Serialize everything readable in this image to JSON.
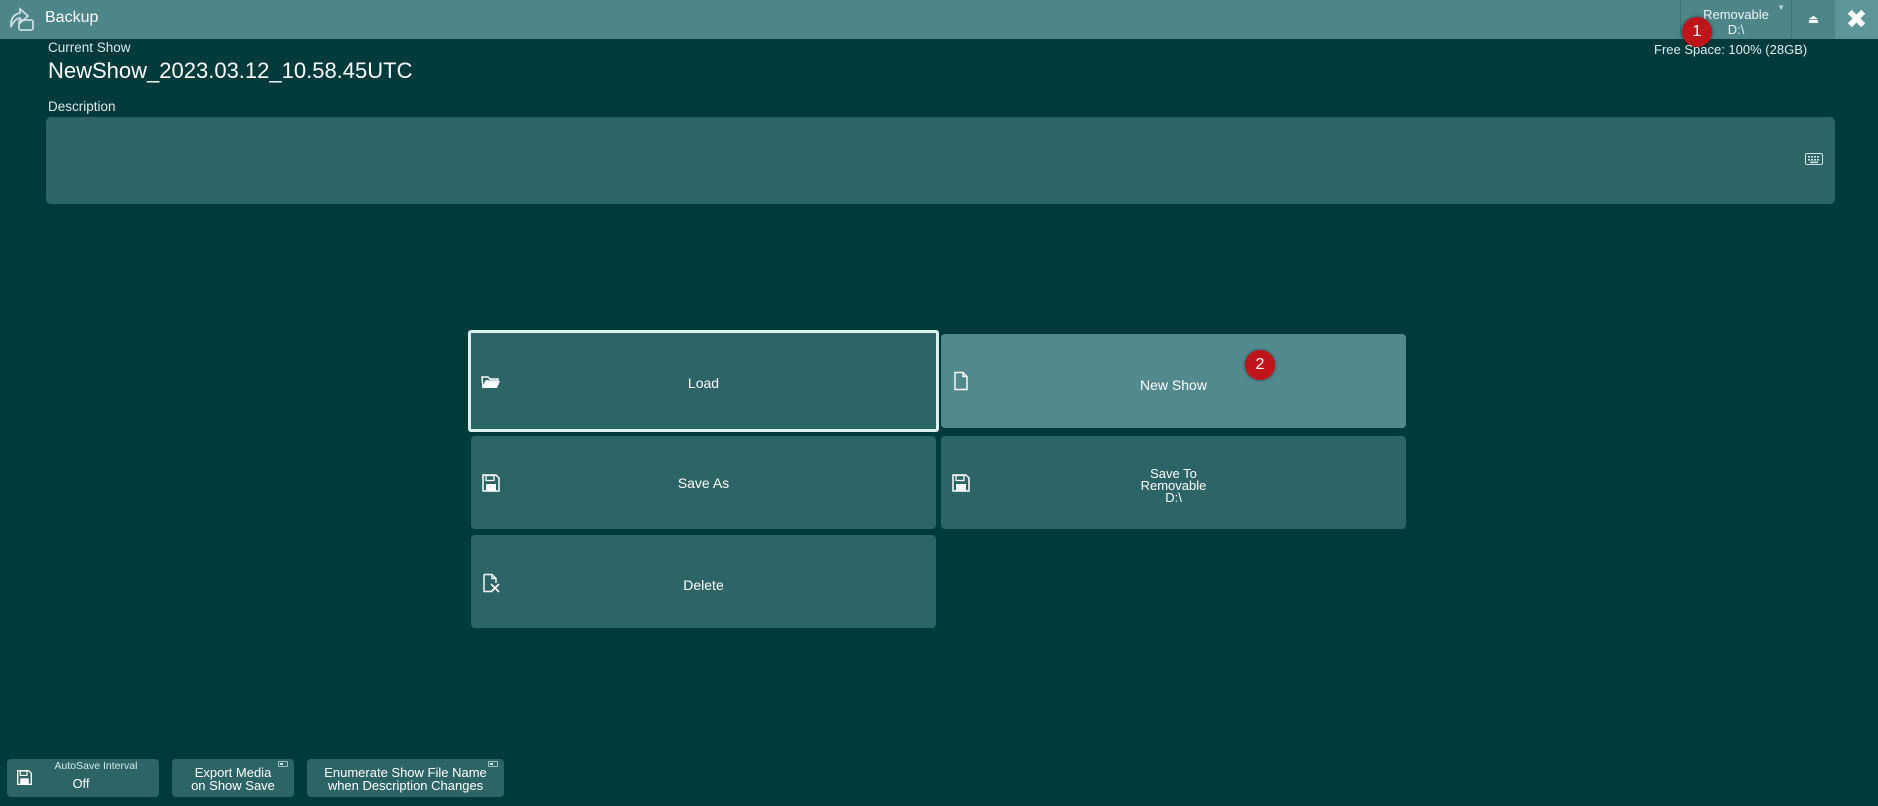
{
  "window": {
    "title": "Backup"
  },
  "drive": {
    "line1": "Removable",
    "line2": "D:\\",
    "free_space": "Free Space: 100% (28GB)"
  },
  "titlebar": {
    "eject_symbol": "⏏",
    "close_symbol": "✖"
  },
  "badges": {
    "one": "1",
    "two": "2"
  },
  "current_show": {
    "label": "Current Show",
    "name": "NewShow_2023.03.12_10.58.45UTC"
  },
  "description": {
    "label": "Description",
    "value": ""
  },
  "actions": {
    "load": "Load",
    "new_show": "New Show",
    "save_as": "Save As",
    "save_to_line1": "Save To",
    "save_to_line2": "Removable",
    "save_to_line3": "D:\\",
    "delete": "Delete"
  },
  "bottom": {
    "autosave_label": "AutoSave Interval",
    "autosave_value": "Off",
    "export_line1": "Export Media",
    "export_line2": "on Show Save",
    "enumerate_line1": "Enumerate Show File Name",
    "enumerate_line2": "when Description Changes"
  },
  "colors": {
    "background": "#003a3a",
    "titlebar": "#4d8589",
    "button": "#2d6466",
    "button_highlight": "#52898d",
    "badge": "#c0141b"
  }
}
